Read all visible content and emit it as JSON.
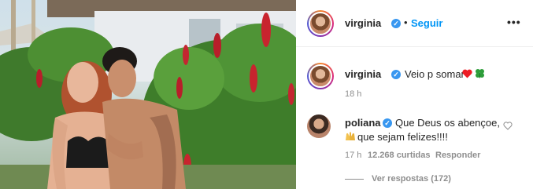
{
  "post": {
    "author": "virginia",
    "follow_label": "Seguir",
    "separator": "•",
    "more_label": "•••"
  },
  "caption": {
    "username": "virginia",
    "text": "Veio p somar",
    "emojis": [
      "red-heart",
      "four-leaf-clover"
    ],
    "time": "18 h"
  },
  "comment": {
    "username": "poliana",
    "text_line1": "Que Deus os abençoe,",
    "text_line2": "que sejam felizes!!!!",
    "emoji": "people-raising-hands",
    "time": "17 h",
    "likes": "12.268 curtidas",
    "reply_label": "Responder",
    "view_replies": "Ver respostas (172)"
  },
  "colors": {
    "link_blue": "#0095f6",
    "verified_blue": "#3897f0",
    "muted": "#8e8e8e",
    "heart_red": "#ed1c24",
    "clover_green": "#2e9e3a"
  }
}
